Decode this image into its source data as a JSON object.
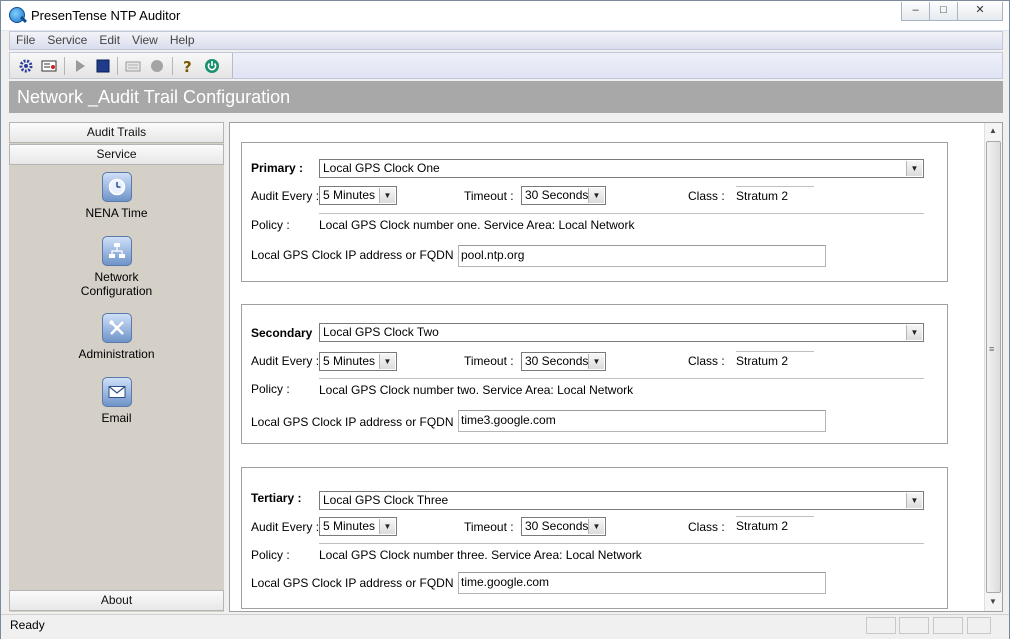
{
  "window": {
    "title": "PresenTense NTP Auditor",
    "controls": {
      "minimize": "–",
      "maximize": "□",
      "close": "✕"
    }
  },
  "menu": [
    "File",
    "Service",
    "Edit",
    "View",
    "Help"
  ],
  "toolbar": [
    "settings-icon",
    "certificate-icon",
    "play-icon",
    "stop-icon",
    "keyboard-icon",
    "record-icon",
    "help-icon",
    "power-icon"
  ],
  "header": {
    "title": "Network _Audit Trail Configuration"
  },
  "sidebar": {
    "tabs": {
      "audit_trails": "Audit Trails",
      "service": "Service",
      "about": "About"
    },
    "items": [
      {
        "label": "NENA Time",
        "icon": "clock-icon"
      },
      {
        "label": "Network\nConfiguration",
        "icon": "network-icon"
      },
      {
        "label": "Administration",
        "icon": "tools-icon"
      },
      {
        "label": "Email",
        "icon": "envelope-icon"
      }
    ]
  },
  "labels": {
    "audit_every": "Audit Every :",
    "timeout": "Timeout :",
    "class": "Class :",
    "policy": "Policy :",
    "ip": "Local GPS Clock IP address or FQDN :"
  },
  "panels": [
    {
      "label": "Primary :",
      "clock": "Local GPS Clock One",
      "audit_every": "5 Minutes",
      "timeout": "30 Seconds",
      "class": "Stratum 2",
      "policy": "Local GPS Clock number one. Service Area: Local Network",
      "ip": "pool.ntp.org"
    },
    {
      "label": "Secondary",
      "clock": "Local GPS Clock Two",
      "audit_every": "5 Minutes",
      "timeout": "30 Seconds",
      "class": "Stratum 2",
      "policy": "Local GPS Clock number two. Service Area: Local Network",
      "ip": "time3.google.com"
    },
    {
      "label": "Tertiary :",
      "clock": "Local GPS Clock Three",
      "audit_every": "5 Minutes",
      "timeout": "30 Seconds",
      "class": "Stratum 2",
      "policy": "Local GPS Clock number three. Service Area: Local Network",
      "ip": "time.google.com"
    }
  ],
  "status": {
    "text": "Ready"
  }
}
